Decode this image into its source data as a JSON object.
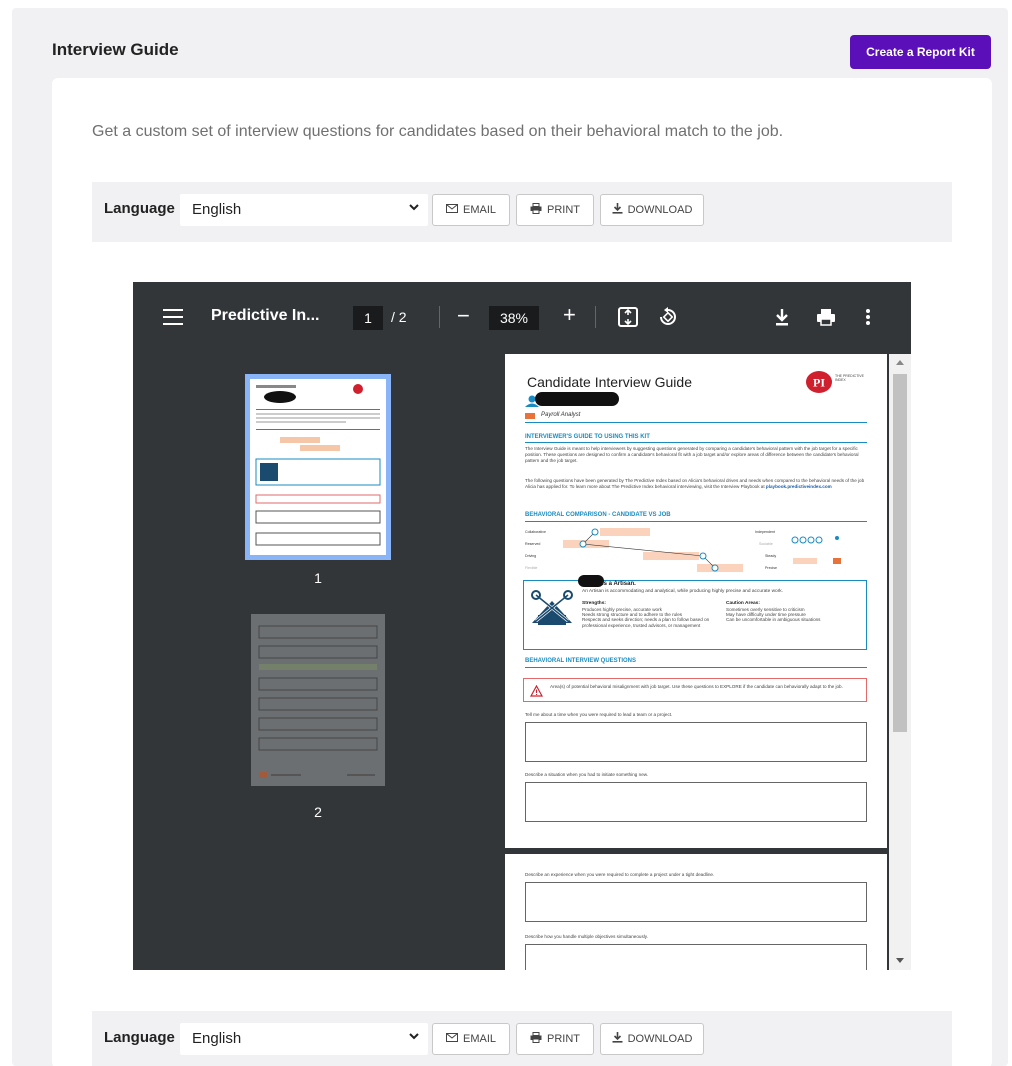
{
  "header": {
    "title": "Interview Guide",
    "create_button": "Create a Report Kit"
  },
  "description": "Get a custom set of interview questions for candidates based on their behavioral match to the job.",
  "toolbar": {
    "language_label": "Language",
    "language_value": "English",
    "email_label": "EMAIL",
    "print_label": "PRINT",
    "download_label": "DOWNLOAD"
  },
  "viewer": {
    "doc_title": "Predictive In...",
    "current_page": "1",
    "total_pages": "/ 2",
    "zoom": "38%",
    "thumb_labels": [
      "1",
      "2"
    ]
  },
  "page": {
    "title": "Candidate Interview Guide",
    "role": "Payroll Analyst",
    "logo_mark": "PI",
    "logo_text": "THE PREDICTIVE INDEX",
    "section1": "INTERVIEWER'S GUIDE TO USING THIS KIT",
    "para1": "The Interview Guide is meant to help interviewers by suggesting questions generated by comparing a candidate's behavioral pattern with the job target for a specific position. These questions are designed to confirm a candidate's behavioral fit with a job target and/or explore areas of difference between the candidate's behavioral pattern and the job target.",
    "para2_pre": "The following questions have been generated by The Predictive Index based on Alicia's behavioral drives and needs when compared to the behavioral needs of the job Alicia has applied for. To learn more about The Predictive Index behavioral interviewing, visit the Interview Playbook at",
    "para2_link": "playbook.predictiveindex.com",
    "section2": "BEHAVIORAL COMPARISON - CANDIDATE VS JOB",
    "chart_left": [
      "Collaborative",
      "Reserved",
      "Driving",
      "Flexible"
    ],
    "chart_right": [
      "Independent",
      "Sociable",
      "Steady",
      "Precise"
    ],
    "artisan_title": "is a Artisan.",
    "artisan_sub": "An Artisan is accommodating and analytical, while producing highly precise and accurate work.",
    "strengths_h": "Strengths:",
    "strengths": [
      "Produces highly precise, accurate work",
      "Needs strong structure and to adhere to the rules",
      "Respects and seeks direction; needs a plan to follow based on professional experience, trusted advisors, or management"
    ],
    "caution_h": "Caution Areas:",
    "caution": [
      "Sometimes overly sensitive to criticism",
      "May have difficulty under time pressure",
      "Can be uncomfortable in ambiguous situations"
    ],
    "section3": "BEHAVIORAL INTERVIEW QUESTIONS",
    "warning": "Area(s) of potential behavioral misalignment with job target. Use these questions to EXPLORE if the candidate can behaviorally adapt to the job.",
    "q1": "Tell me about a time when you were required to lead a team or a project.",
    "q2": "Describe a situation when you had to initiate something new.",
    "q3": "Describe an experience when you were required to complete a project under a tight deadline.",
    "q4": "Describe how you handle multiple objectives simultaneously."
  },
  "colors": {
    "accent": "#5b0fb8",
    "viewer_bg": "#323639",
    "pi_blue": "#1a8bc1",
    "pi_red": "#d0202e"
  }
}
